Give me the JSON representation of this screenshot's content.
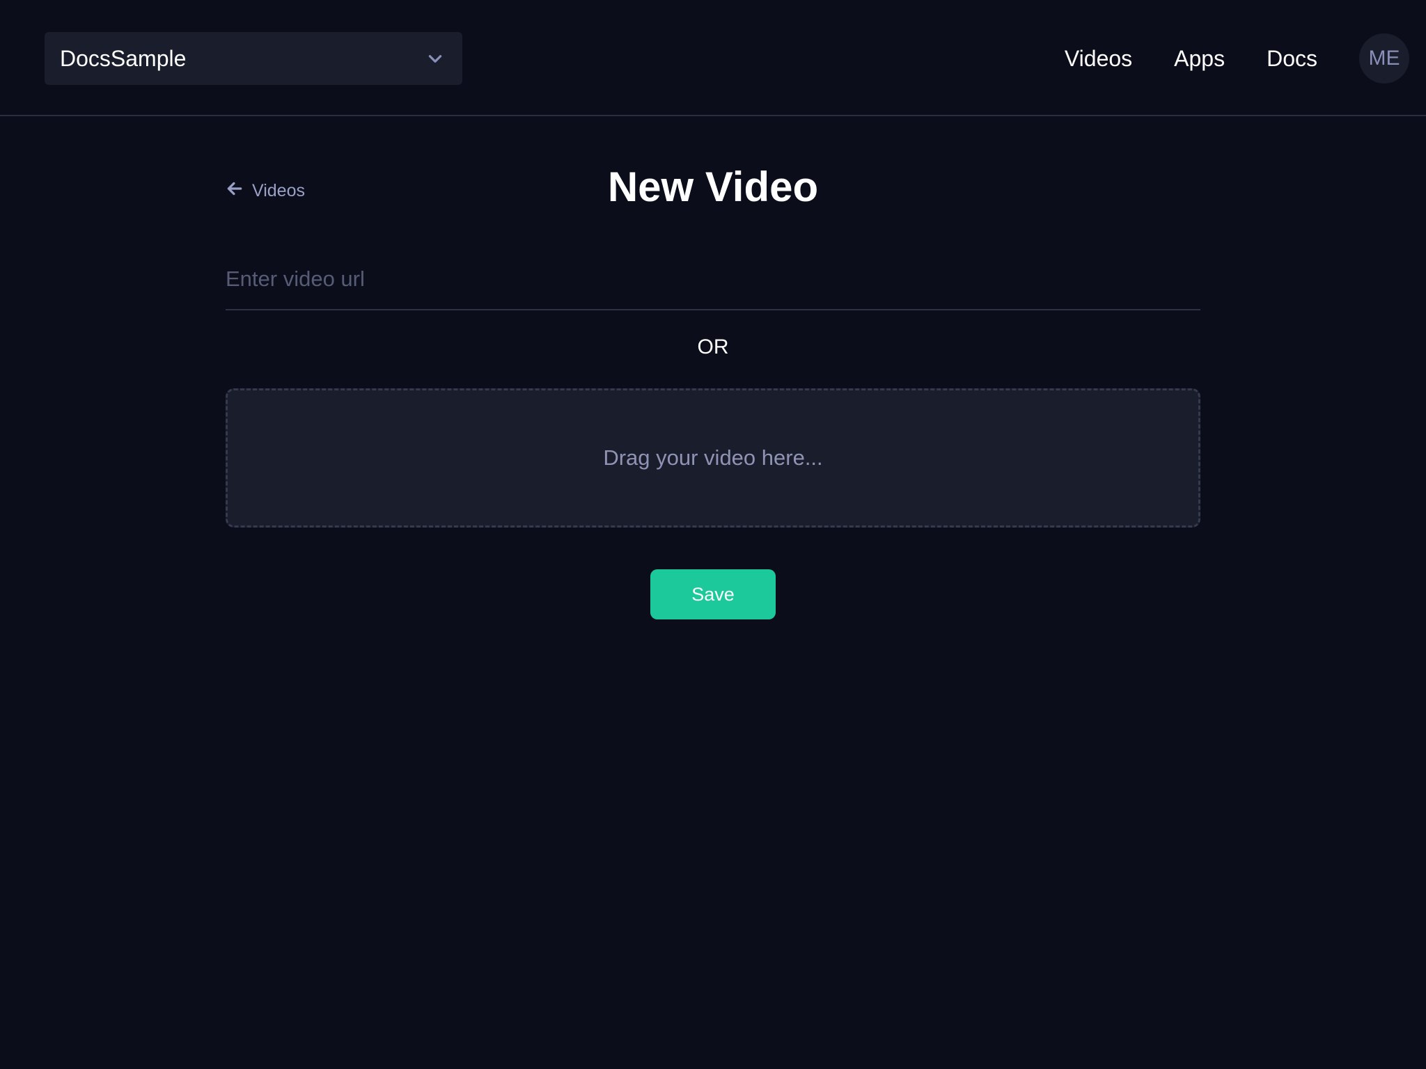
{
  "header": {
    "app_selector": {
      "value": "DocsSample",
      "icon": "chevron-down-icon"
    },
    "nav": [
      {
        "label": "Videos"
      },
      {
        "label": "Apps"
      },
      {
        "label": "Docs"
      }
    ],
    "avatar_initials": "ME"
  },
  "main": {
    "back_link": {
      "label": "Videos",
      "icon": "arrow-left-icon"
    },
    "title": "New Video",
    "url_input": {
      "value": "",
      "placeholder": "Enter video url"
    },
    "or_label": "OR",
    "dropzone_label": "Drag your video here...",
    "save_label": "Save"
  },
  "colors": {
    "background": "#0b0e1a",
    "surface": "#1a1d2b",
    "accent": "#1cc99b",
    "muted_text": "#8f94b5",
    "divider": "#2a2e3e"
  }
}
